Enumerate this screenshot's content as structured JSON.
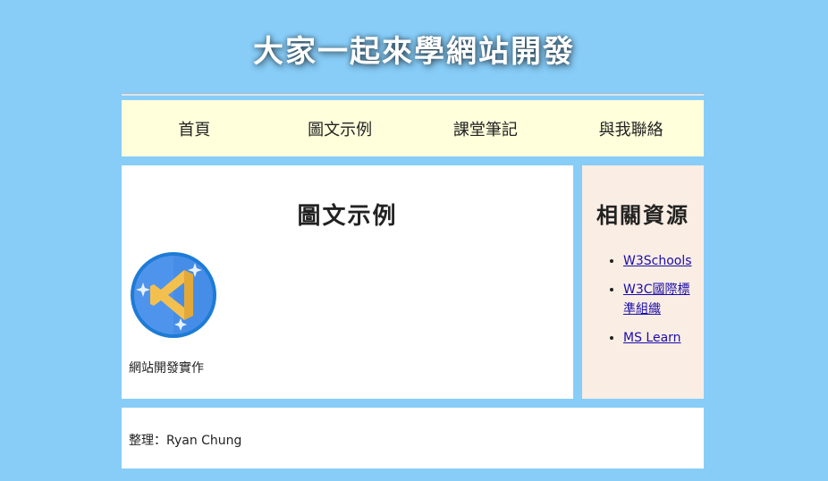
{
  "header": {
    "title": "大家一起來學網站開發"
  },
  "nav": {
    "items": [
      {
        "label": "首頁"
      },
      {
        "label": "圖文示例"
      },
      {
        "label": "課堂筆記"
      },
      {
        "label": "與我聯絡"
      }
    ]
  },
  "main": {
    "title": "圖文示例",
    "logo_icon": "vscode-logo-icon",
    "caption": "網站開發實作"
  },
  "aside": {
    "title": "相關資源",
    "links": [
      {
        "label": "W3Schools"
      },
      {
        "label": "W3C國際標準組織"
      },
      {
        "label": "MS Learn"
      }
    ]
  },
  "footer": {
    "text": "整理：Ryan Chung"
  },
  "colors": {
    "page_background": "#87cdf8",
    "nav_background": "#ffffdc",
    "aside_background": "#faede3",
    "link": "#1a0dab"
  }
}
